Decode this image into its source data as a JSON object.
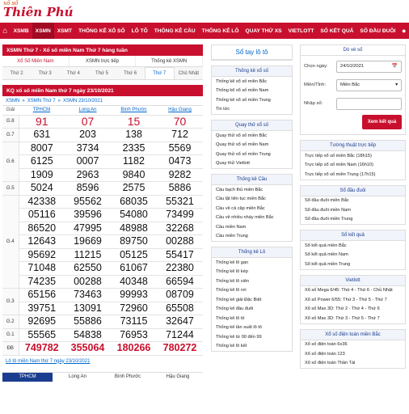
{
  "logo": {
    "small": "xổ số",
    "big": "Thiên Phú"
  },
  "nav": {
    "items": [
      "XSMB",
      "XSMN",
      "XSMT",
      "THỐNG KÊ XỔ SỐ",
      "LÔ TÔ",
      "THỐNG KÊ CẦU",
      "THỐNG KÊ LÔ",
      "QUAY THỬ XS",
      "VIETLOTT",
      "SỐ KẾT QUẢ",
      "SỐ ĐẦU ĐUÔI"
    ]
  },
  "main": {
    "panel_title": "XSMN Thứ 7 - Xổ số miền Nam Thứ 7 hàng tuần",
    "tabs1": [
      "Xổ Số Miền Nam",
      "XSMN trực tiếp",
      "Thống kê XSMN"
    ],
    "tabs2": [
      "Thứ 2",
      "Thứ 3",
      "Thứ 4",
      "Thứ 5",
      "Thứ 6",
      "Thứ 7",
      "Chủ Nhật"
    ],
    "kq_title": "KQ xổ số miền Nam thứ 7 ngày 23/10/2021",
    "breadcrumb": [
      "XSMN",
      "»",
      "XSMN Thứ 7",
      "»",
      "XSMN 23/10/2021"
    ],
    "col_giai": "Giải",
    "provinces": [
      "TPHCM",
      "Long An",
      "Bình Phước",
      "Hậu Giang"
    ],
    "prizes": [
      {
        "name": "G.8",
        "rows": [
          [
            "91",
            "07",
            "15",
            "70"
          ]
        ],
        "style": "big"
      },
      {
        "name": "G.7",
        "rows": [
          [
            "631",
            "203",
            "138",
            "712"
          ]
        ]
      },
      {
        "name": "G.6",
        "rows": [
          [
            "8007",
            "3734",
            "2335",
            "5569"
          ],
          [
            "6125",
            "0007",
            "1182",
            "0473"
          ],
          [
            "1909",
            "2963",
            "9840",
            "9282"
          ]
        ]
      },
      {
        "name": "G.5",
        "rows": [
          [
            "5024",
            "8596",
            "2575",
            "5886"
          ]
        ]
      },
      {
        "name": "G.4",
        "rows": [
          [
            "42338",
            "95562",
            "68035",
            "55321"
          ],
          [
            "05116",
            "39596",
            "54080",
            "73499"
          ],
          [
            "86520",
            "47995",
            "48988",
            "32268"
          ],
          [
            "12643",
            "19669",
            "89750",
            "00288"
          ],
          [
            "95692",
            "11215",
            "05125",
            "55417"
          ],
          [
            "71048",
            "62550",
            "61067",
            "22380"
          ],
          [
            "74235",
            "00288",
            "40348",
            "66594"
          ]
        ]
      },
      {
        "name": "G.3",
        "rows": [
          [
            "65156",
            "73463",
            "99993",
            "08709"
          ],
          [
            "39751",
            "13091",
            "72960",
            "65508"
          ]
        ]
      },
      {
        "name": "G.2",
        "rows": [
          [
            "92695",
            "55886",
            "73115",
            "32647"
          ]
        ]
      },
      {
        "name": "G.1",
        "rows": [
          [
            "55565",
            "54838",
            "76953",
            "71244"
          ]
        ]
      },
      {
        "name": "ĐB",
        "rows": [
          [
            "749782",
            "355064",
            "180266",
            "780272"
          ]
        ],
        "style": "db"
      }
    ],
    "footer_link": "Lô tô miền Nam thứ 7 ngày 23/10/2021",
    "bottom_tabs": [
      "TPHCM",
      "Long An",
      "Bình Phước",
      "Hậu Giang"
    ]
  },
  "col2": {
    "so_tay": "Sổ tay lô tô",
    "thongke_title": "Thống kê xổ số",
    "thongke": [
      "Thống kê xổ số miền Bắc",
      "Thống kê xổ số miền Nam",
      "Thống kê xổ số miền Trung",
      "Tin tức"
    ],
    "quaythu_title": "Quay thử xổ số",
    "quaythu": [
      "Quay thử xổ số miền Bắc",
      "Quay thử xổ số miền Nam",
      "Quay thử xổ số miền Trung",
      "Quay thử Vietlott"
    ],
    "cau_title": "Thống kê Cầu",
    "cau": [
      "Cầu bạch thủ miền Bắc",
      "Cầu lật liên tục miền Bắc",
      "Cầu về cả cặp miền Bắc",
      "Cầu về nhiều nháy miền Bắc",
      "Cầu miền Nam",
      "Cầu miền Trung"
    ],
    "lo_title": "Thống kê Lô",
    "lo": [
      "Thống kê lô gan",
      "Thống kê lô kép",
      "Thống kê lô xiên",
      "Thống kê lô rơi",
      "Thống kê giải Đặc Biệt",
      "Thống kê đầu đuôi",
      "Thống kê lô tô",
      "Thống kê tần suất lô tô",
      "Thống kê từ 00 đến 99",
      "Thống kê lô kết"
    ]
  },
  "col3": {
    "doveso_title": "Dò vé số",
    "chon_ngay_label": "Chọn ngày:",
    "chon_ngay_value": "24/10/2021",
    "mien_label": "Miền/Tỉnh:",
    "mien_value": "Miền Bắc",
    "nhap_label": "Nhập số:",
    "nhap_placeholder": "",
    "btn": "Xem kết quả",
    "tuongthuat_title": "Tường thuật trực tiếp",
    "tuongthuat": [
      "Trực tiếp xổ số miền Bắc (18h15)",
      "Trực tiếp xổ số miền Nam (16h10)",
      "Trực tiếp xổ số miền Trung (17h15)"
    ],
    "daudui_title": "Sổ đầu đuôi",
    "daudui": [
      "Sổ đầu đuôi miền Bắc",
      "Sổ đầu đuôi miền Nam",
      "Sổ đầu đuôi miền Trung"
    ],
    "soketqua_title": "Sổ kết quả",
    "soketqua": [
      "Sổ kết quả miền Bắc",
      "Sổ kết quả miền Nam",
      "Sổ kết quả miền Trung"
    ],
    "vietlott_title": "Vietlott",
    "vietlott": [
      "Xổ số Mega 6/45: Thứ 4 - Thứ 6 - Chủ Nhật",
      "Xổ số Power 6/55: Thứ 3 - Thứ 5 - Thứ 7",
      "Xổ số Max 3D: Thứ 2 - Thứ 4 - Thứ 6",
      "Xổ số Max 3D: Thứ 3 - Thứ 5 - Thứ 7"
    ],
    "dientoan_title": "Xổ số điện toán miền Bắc",
    "dientoan": [
      "Xổ số điện toán 6x36",
      "Xổ số điện toán 123",
      "Xổ số điện toán Thần Tài"
    ]
  }
}
